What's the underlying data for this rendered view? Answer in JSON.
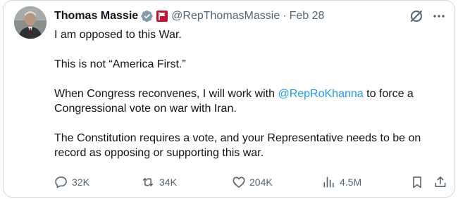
{
  "author": {
    "name": "Thomas Massie",
    "handle": "@RepThomasMassie",
    "separator": "·",
    "date": "Feb 28"
  },
  "tweet": {
    "paragraph1": "I am opposed to this War.",
    "paragraph2": "This is not “America First.”",
    "paragraph3_pre": "When Congress reconvenes, I will work with ",
    "paragraph3_mention": "@RepRoKhanna",
    "paragraph3_post": " to force a Congressional vote on war with Iran.",
    "paragraph4": "The Constitution requires a vote, and your Representative needs to be on record as opposing or supporting this war."
  },
  "metrics": {
    "replies": "32K",
    "reposts": "34K",
    "likes": "204K",
    "views": "4.5M"
  },
  "icons": {
    "verified": "verified-badge-icon",
    "flag": "government-flag-icon",
    "grok": "grok-icon",
    "more": "more-icon",
    "reply": "reply-icon",
    "repost": "repost-icon",
    "like": "like-icon",
    "views": "views-icon",
    "bookmark": "bookmark-icon",
    "share": "share-icon"
  },
  "colors": {
    "text": "#0f1419",
    "muted": "#536471",
    "link": "#1d9bf0",
    "flag_red": "#c8102e"
  }
}
